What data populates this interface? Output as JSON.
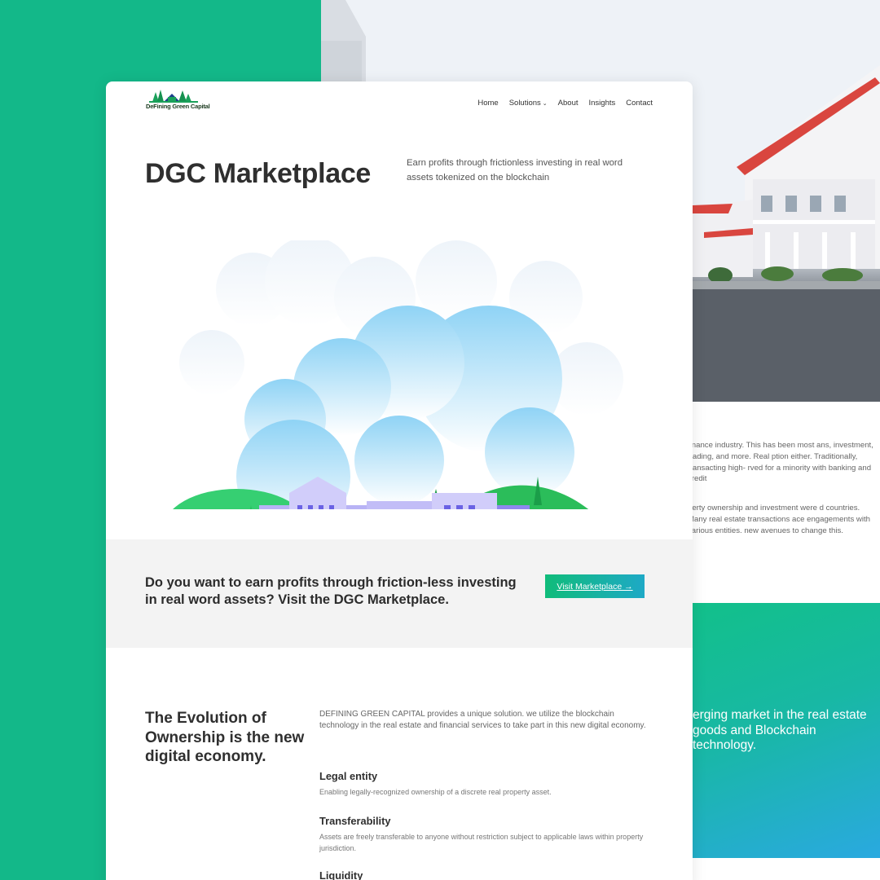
{
  "site": {
    "logo_text": "DeFining Green Capital",
    "nav": [
      "Home",
      "Solutions",
      "About",
      "Insights",
      "Contact"
    ]
  },
  "hero": {
    "title": "DGC Marketplace",
    "subtitle": "Earn profits through frictionless investing in real word assets tokenized on the blockchain"
  },
  "cta": {
    "text": "Do you want to earn profits through friction-less investing in real word assets? Visit the DGC Marketplace.",
    "button": "Visit Marketplace →"
  },
  "evolution": {
    "title": "The Evolution of Ownership is the new digital economy.",
    "body": "DEFINING GREEN CAPITAL provides a unique solution. we utilize the blockchain technology in the real estate and financial services to take part in this new digital economy.",
    "features": [
      {
        "title": "Legal entity",
        "desc": "Enabling legally-recognized ownership of a discrete real property asset."
      },
      {
        "title": "Transferability",
        "desc": "Assets are freely transferable to anyone without restriction subject to applicable laws within property jurisdiction."
      },
      {
        "title": "Liquidity",
        "desc": ""
      }
    ]
  },
  "background_page": {
    "article_p1": "finance industry. This has been most ans, investment, trading, and more. Real ption either. Traditionally, transacting high- rved for a minority with banking and credit",
    "article_p2": "perty ownership and investment were d countries. Many real estate transactions ace engagements with various entities. new avenues to change this.",
    "band_text": "erging market in the real estate goods and Blockchain technology."
  },
  "colors": {
    "brand_green": "#13b889",
    "button_gradient_start": "#10bc7a",
    "button_gradient_end": "#1ea9c6",
    "cta_band_bg": "#f3f3f3"
  }
}
